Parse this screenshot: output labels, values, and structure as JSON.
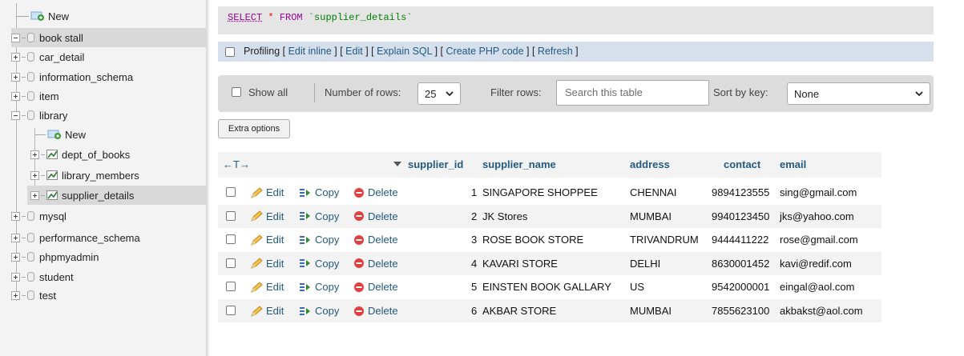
{
  "nav": {
    "items": [
      {
        "label": "New"
      },
      {
        "label": "book stall"
      },
      {
        "label": "car_detail"
      },
      {
        "label": "information_schema"
      },
      {
        "label": "item"
      },
      {
        "label": "library"
      },
      {
        "label": "New"
      },
      {
        "label": "dept_of_books"
      },
      {
        "label": "library_members"
      },
      {
        "label": "supplier_details"
      },
      {
        "label": "mysql"
      },
      {
        "label": "performance_schema"
      },
      {
        "label": "phpmyadmin"
      },
      {
        "label": "student"
      },
      {
        "label": "test"
      }
    ]
  },
  "query": {
    "select": "SELECT",
    "star": "*",
    "from": "FROM",
    "table": "`supplier_details`"
  },
  "profiling": {
    "label": "Profiling",
    "links": [
      "Edit inline",
      "Edit",
      "Explain SQL",
      "Create PHP code",
      "Refresh"
    ]
  },
  "navbar": {
    "show_all": "Show all",
    "rows_label": "Number of rows:",
    "rows_value": "25",
    "filter_label": "Filter rows:",
    "search_placeholder": "Search this table",
    "sort_label": "Sort by key:",
    "sort_value": "None"
  },
  "extra_options": "Extra options",
  "table": {
    "nav_arrows": "←T→",
    "headers": [
      "supplier_id",
      "supplier_name",
      "address",
      "contact",
      "email"
    ],
    "actions": {
      "edit": "Edit",
      "copy": "Copy",
      "delete": "Delete"
    },
    "rows": [
      {
        "supplier_id": "1",
        "supplier_name": "SINGAPORE SHOPPEE",
        "address": "CHENNAI",
        "contact": "9894123555",
        "email": "sing@gmail.com"
      },
      {
        "supplier_id": "2",
        "supplier_name": "JK Stores",
        "address": "MUMBAI",
        "contact": "9940123450",
        "email": "jks@yahoo.com"
      },
      {
        "supplier_id": "3",
        "supplier_name": "ROSE BOOK STORE",
        "address": "TRIVANDRUM",
        "contact": "9444411222",
        "email": "rose@gmail.com"
      },
      {
        "supplier_id": "4",
        "supplier_name": "KAVARI STORE",
        "address": "DELHI",
        "contact": "8630001452",
        "email": "kavi@redif.com"
      },
      {
        "supplier_id": "5",
        "supplier_name": "EINSTEN BOOK GALLARY",
        "address": "US",
        "contact": "9542000001",
        "email": "eingal@aol.com"
      },
      {
        "supplier_id": "6",
        "supplier_name": "AKBAR STORE",
        "address": "MUMBAI",
        "contact": "7855623100",
        "email": "akbakst@aol.com"
      }
    ]
  }
}
